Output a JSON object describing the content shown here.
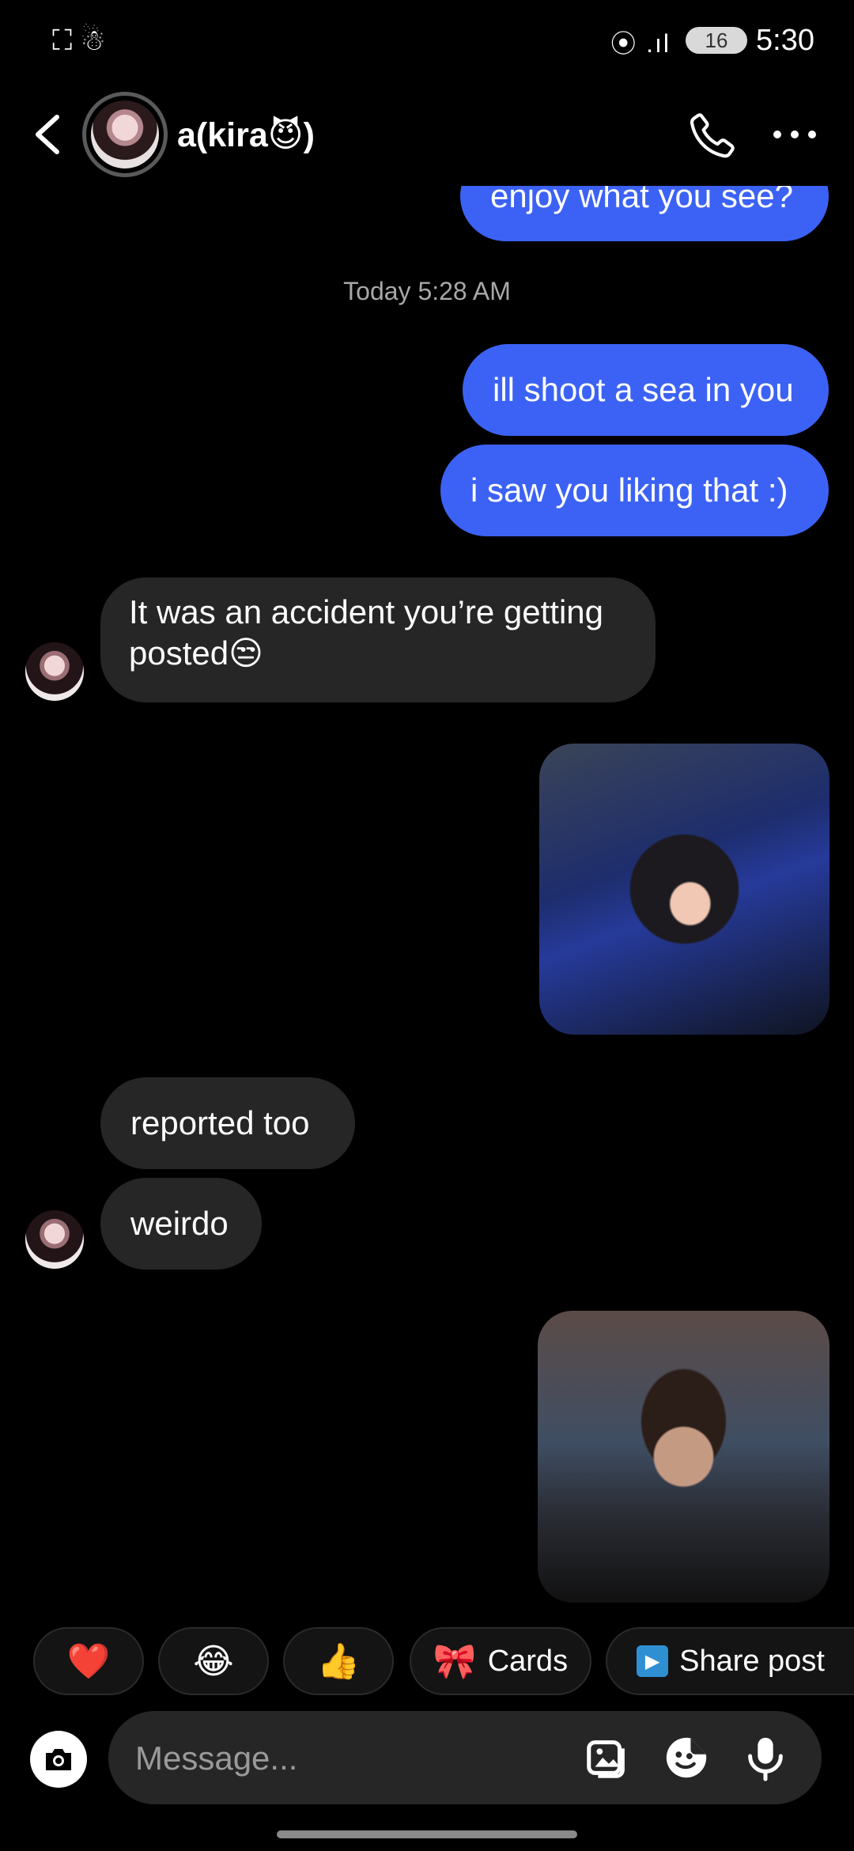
{
  "status_bar": {
    "time": "5:30",
    "battery": "16",
    "signal": "⦿ .ıl"
  },
  "header": {
    "contact_name": "a(kira😈)"
  },
  "messages": {
    "partial_top": "enjoy what you see?",
    "timestamp": "Today 5:28 AM",
    "out1": "ill shoot a sea in you",
    "out2": "i saw you liking that :)",
    "in1": "It was an accident you’re getting posted😒",
    "in2": "reported too",
    "in3": "weirdo"
  },
  "quick_replies": [
    {
      "emoji": "❤️"
    },
    {
      "emoji": "😂"
    },
    {
      "emoji": "👍"
    },
    {
      "emoji": "🎀",
      "label": "Cards"
    },
    {
      "emoji": "▶",
      "label": "Share post"
    }
  ],
  "composer": {
    "placeholder": "Message..."
  },
  "colors": {
    "outgoing_bubble": "#3c62f5",
    "incoming_bubble": "#262626",
    "background": "#000000"
  },
  "icons": [
    "back-icon",
    "phone-icon",
    "more-icon",
    "camera-icon",
    "gallery-icon",
    "sticker-icon",
    "mic-icon"
  ]
}
